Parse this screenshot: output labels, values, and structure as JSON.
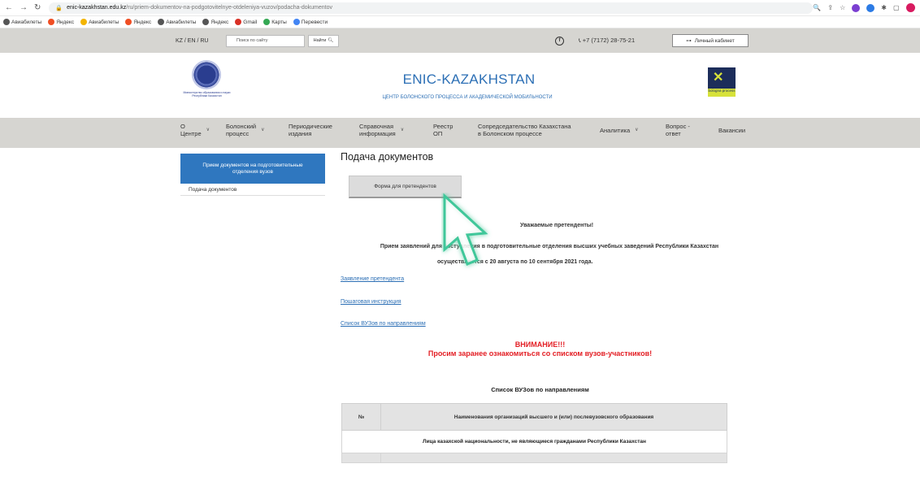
{
  "browser": {
    "url_domain": "enic-kazakhstan.edu.kz",
    "url_path": "/ru/priem-dokumentov-na-podgotovitelnye-otdeleniya-vuzov/podacha-dokumentov",
    "bookmarks": [
      "Авиабилеты",
      "Яндекс",
      "Авиабилеты",
      "Яндекс",
      "Авиабилеты",
      "Яндекс",
      "Gmail",
      "Карты",
      "Перевести"
    ]
  },
  "topbar": {
    "lang": "KZ / EN / RU",
    "search_placeholder": "Поиск по сайту",
    "find_label": "Найти",
    "phone": "+7 (7172) 28-75-21",
    "cabinet_label": "Личный кабинет"
  },
  "header": {
    "title": "ENIC-KAZAKHSTAN",
    "subtitle": "ЦЕНТР БОЛОНСКОГО ПРОЦЕССА И АКАДЕМИЧЕСКОЙ МОБИЛЬНОСТИ",
    "left_logo_caption": "Министерство образования и науки Республики Казахстан",
    "right_logo_caption": "bologna process"
  },
  "nav": {
    "items": [
      {
        "line1": "О",
        "line2": "Центре"
      },
      {
        "line1": "Болонский",
        "line2": "процесс"
      },
      {
        "line1": "Периодические",
        "line2": "издания"
      },
      {
        "line1": "Справочная",
        "line2": "информация"
      },
      {
        "line1": "Реестр",
        "line2": "ОП"
      },
      {
        "line1": "Сопредседательство Казахстана",
        "line2": "в Болонском процессе"
      },
      {
        "line1": "Аналитика",
        "line2": ""
      },
      {
        "line1": "Вопрос -",
        "line2": "ответ"
      },
      {
        "line1": "Вакансии",
        "line2": ""
      }
    ]
  },
  "sidebar": {
    "heading": "Прием документов на подготовительные отделения вузов",
    "item": "Подача документов"
  },
  "main": {
    "page_title": "Подача документов",
    "form_button": "Форма для претендентов",
    "greeting": "Уважаемые претенденты!",
    "notice_line1": "Прием заявлений для поступления в подготовительные отделения высших учебных заведений Республики Казахстан",
    "notice_line2": "осуществляется с 20 августа по 10 сентября 2021 года.",
    "links": [
      "Заявление претендента",
      "Пошаговая инструкция",
      "Список ВУЗов по направлениям"
    ],
    "warning_1": "ВНИМАНИЕ!!!",
    "warning_2": "Просим заранее ознакомиться со списком вузов-участников!",
    "table_title": "Список ВУЗов по направлениям",
    "table_headers": [
      "№",
      "Наименования организаций высшего и (или) послевузовского образования"
    ],
    "table_row_1": "Лица казахской национальности, не являющиеся гражданами Республики Казахстан"
  }
}
